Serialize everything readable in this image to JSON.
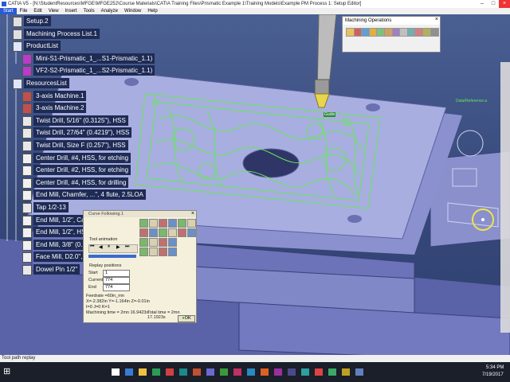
{
  "window": {
    "title": "CATIA V5 - [N:\\StudentResources\\MFGE\\MFGE252\\Course Materials\\CATIA Training Files\\Prismatic Example 1\\Training Models\\Example PM Process 1: Setup Editor]"
  },
  "menu": [
    "Start",
    "File",
    "Edit",
    "View",
    "Insert",
    "Tools",
    "Analyze",
    "Window",
    "Help"
  ],
  "tree": [
    {
      "label": "Setup.2",
      "icon": "setup-icon"
    },
    {
      "label": "Machining Process List.1",
      "icon": "process-list-icon"
    },
    {
      "label": "ProductList",
      "icon": "product-list-icon"
    },
    {
      "label": "Mini-S1-Prismatic_1_...S1-Prismatic_1.1)",
      "icon": "part-icon"
    },
    {
      "label": "VF2-S2-Prismatic_1_...S2-Prismatic_1.1)",
      "icon": "part-icon"
    },
    {
      "label": "ResourcesList",
      "icon": "resources-list-icon"
    },
    {
      "label": "3-axis Machine.1",
      "icon": "machine-icon"
    },
    {
      "label": "3-axis Machine.2",
      "icon": "machine-icon"
    },
    {
      "label": "Twist Drill, 5/16\" (0.3125\"), HSS",
      "icon": "drill-icon"
    },
    {
      "label": "Twist Drill, 27/64\" (0.4219\"), HSS",
      "icon": "drill-icon"
    },
    {
      "label": "Twist Drill, Size F (0.257\"), HSS",
      "icon": "drill-icon"
    },
    {
      "label": "Center Drill, #4, HSS, for etching",
      "icon": "center-drill-icon"
    },
    {
      "label": "Center Drill, #2, HSS, for etching",
      "icon": "center-drill-icon"
    },
    {
      "label": "Center Drill, #4, HSS, for drilling",
      "icon": "center-drill-icon"
    },
    {
      "label": "End Mill, Chamfer, ...\", 4 flute, 2.5LOA",
      "icon": "end-mill-icon"
    },
    {
      "label": "Tap 1/2-13",
      "icon": "tap-icon"
    },
    {
      "label": "End Mill, 1/2\", Car...tes, 1\" LoC, 3\"LOA",
      "icon": "end-mill-icon"
    },
    {
      "label": "End Mill, 1/2\", HSS",
      "icon": "end-mill-icon"
    },
    {
      "label": "End Mill, 3/8\" (0.",
      "icon": "end-mill-icon"
    },
    {
      "label": "Face Mill, D2.0\", 0.",
      "icon": "face-mill-icon"
    },
    {
      "label": "Dowel Pin 1/2\"",
      "icon": "dowel-pin-icon"
    }
  ],
  "machining_operations_palette": {
    "title": "Machining Operations",
    "buttons": [
      "op1",
      "op2",
      "op3",
      "op4",
      "op5",
      "op6",
      "op7",
      "op8",
      "op9",
      "op10",
      "op11",
      "op12"
    ]
  },
  "tool_label": "Guide",
  "axis_label": "Data/Reference.a",
  "animation_dialog": {
    "title": "Curve Following.1",
    "tool_animation_label": "Tool animation",
    "replay_positions_label": "Replay positions",
    "start_label": "Start",
    "start_value": "1",
    "current_label": "Current",
    "current_value": "774",
    "end_label": "End",
    "end_value": "774",
    "feedrate": "Feedrate =60in_mn",
    "coords": "X=-2.382in Y=-1.164in Z=-0.01in",
    "ijk": "I=0 J=0 K=1",
    "machining_time": "Machining time = 2mn 16.9423s",
    "total_time": "Total time = 2mn 17.1923s",
    "ok_label": "OK",
    "progress_fraction": 1.0
  },
  "status_bar": "Tool path replay",
  "taskbar": {
    "time": "5:34 PM",
    "date": "7/19/2017"
  },
  "colors": {
    "tree_bg": "#1e2b55",
    "toolpath": "#64e85a",
    "plate_top": "#a8aedf",
    "accent": "#2a5bd7"
  }
}
